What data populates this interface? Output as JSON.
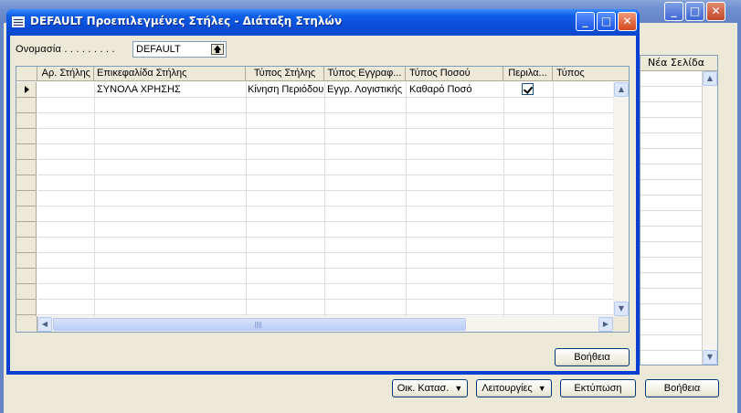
{
  "background_window": {
    "controls": {
      "minimize": "_",
      "maximize": "□",
      "close": "✕"
    },
    "grid_header": "Νέα Σελίδα",
    "buttons": {
      "menu_1": "Οικ. Κατασ.",
      "menu_2": "Λειτουργίες",
      "print": "Εκτύπωση",
      "help": "Βοήθεια"
    }
  },
  "dialog": {
    "title": "DEFAULT Προεπιλεγμένες Στήλες - Διάταξη Στηλών",
    "controls": {
      "minimize": "_",
      "maximize": "□",
      "close": "✕"
    },
    "name_field": {
      "label": "Ονομασία . . . . . . . . .",
      "value": "DEFAULT"
    },
    "grid": {
      "columns": [
        "Αρ. Στήλης",
        "Επικεφαλίδα Στήλης",
        "Τύπος Στήλης",
        "Τύπος Εγγραφ...",
        "Τύπος Ποσού",
        "Περιλα...",
        "Τύπος"
      ],
      "rows": [
        {
          "col_no": "",
          "heading": "ΣΥΝΟΛΑ ΧΡΗΣΗΣ",
          "col_type": "Κίνηση Περιόδου",
          "entry_type": "Εγγρ. Λογιστικής",
          "amount_type": "Καθαρό Ποσό",
          "included": true,
          "type": ""
        }
      ]
    },
    "help_button": "Βοήθεια"
  },
  "icons": [
    "table-icon",
    "lookup-arrow-icon",
    "scroll-up-icon",
    "scroll-down-icon",
    "scroll-left-icon",
    "scroll-right-icon",
    "checkmark-icon",
    "dropdown-arrow-icon",
    "row-pointer-icon"
  ]
}
